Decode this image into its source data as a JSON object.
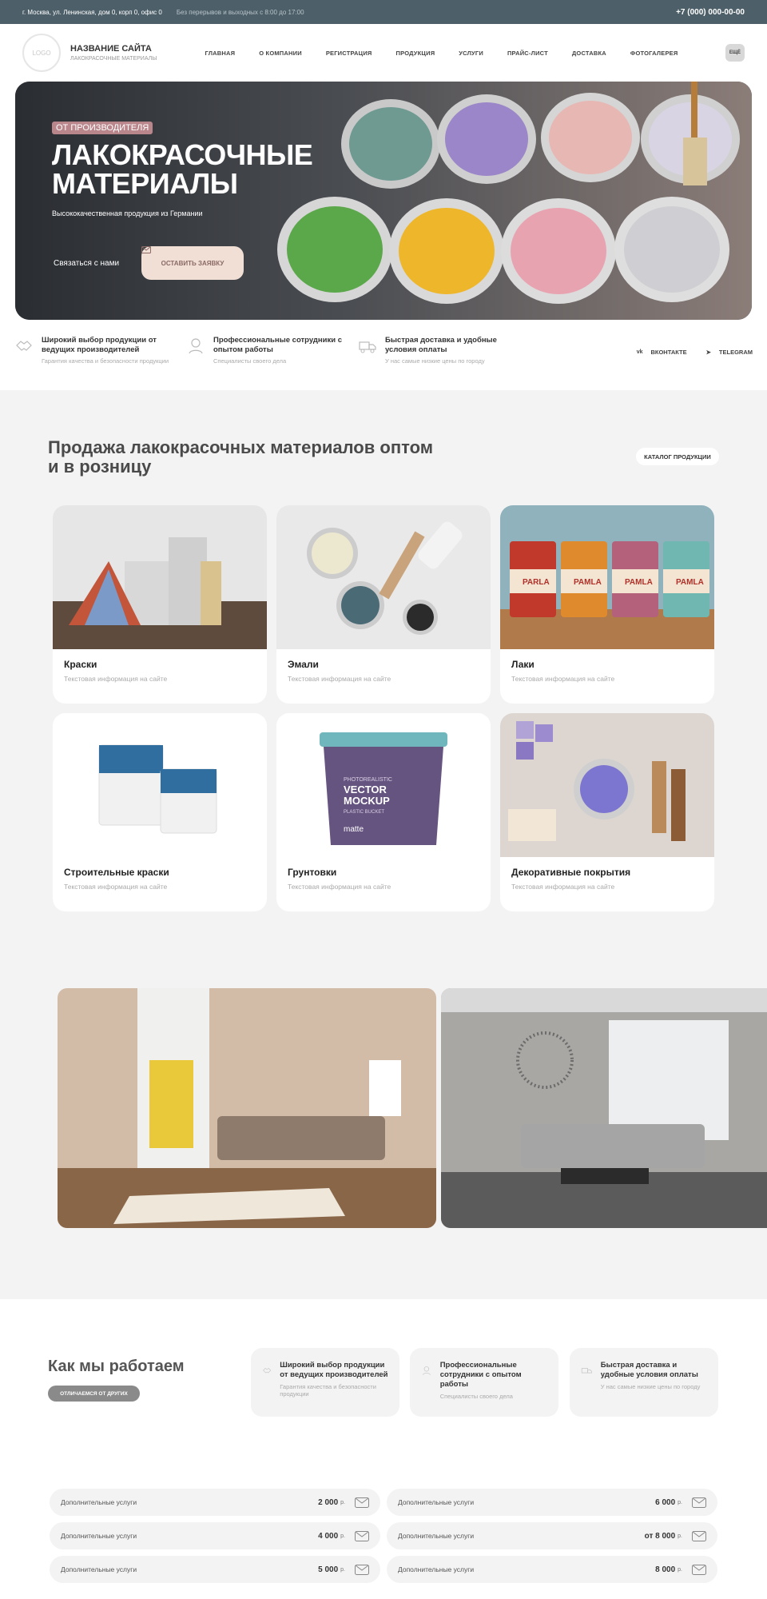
{
  "topbar": {
    "address": "г. Москва, ул. Ленинская, дом 0, корп 0, офис 0",
    "hours": "Без перерывов и выходных с 8:00 до 17:00",
    "phone": "+7 (000) 000-00-00"
  },
  "header": {
    "logo": "LOGO",
    "site_name": "НАЗВАНИЕ САЙТА",
    "site_sub": "ЛАКОКРАСОЧНЫЕ МАТЕРИАЛЫ",
    "nav": [
      "ГЛАВНАЯ",
      "О КОМПАНИИ",
      "РЕГИСТРАЦИЯ",
      "ПРОДУКЦИЯ",
      "УСЛУГИ",
      "ПРАЙС-ЛИСТ",
      "ДОСТАВКА",
      "ФОТОГАЛЕРЕЯ"
    ],
    "more": "ЕЩЁ"
  },
  "hero": {
    "badge": "ОТ ПРОИЗВОДИТЕЛЯ",
    "title_1": "ЛАКОКРАСОЧНЫЕ",
    "title_2": "МАТЕРИАЛЫ",
    "subtitle": "Высококачественная продукция из Германии",
    "contact": "Связаться с нами",
    "cta": "ОСТАВИТЬ ЗАЯВКУ"
  },
  "features": [
    {
      "title": "Широкий выбор продукции от ведущих производителей",
      "desc": "Гарантия качества и безопасности продукции"
    },
    {
      "title": "Профессиональные сотрудники с опытом работы",
      "desc": "Специалисты своего дела"
    },
    {
      "title": "Быстрая доставка и удобные условия оплаты",
      "desc": "У нас самые низкие цены по городу"
    }
  ],
  "social": {
    "vk": "ВКОНТАКТЕ",
    "tg": "TELEGRAM"
  },
  "catalog": {
    "title": "Продажа лакокрасочных материалов оптом и в розницу",
    "button": "КАТАЛОГ ПРОДУКЦИИ",
    "items": [
      {
        "name": "Краски",
        "desc": "Текстовая информация на сайте"
      },
      {
        "name": "Эмали",
        "desc": "Текстовая информация на сайте"
      },
      {
        "name": "Лаки",
        "desc": "Текстовая информация на сайте"
      },
      {
        "name": "Строительные краски",
        "desc": "Текстовая информация на сайте"
      },
      {
        "name": "Грунтовки",
        "desc": "Текстовая информация на сайте"
      },
      {
        "name": "Декоративные покрытия",
        "desc": "Текстовая информация на сайте"
      }
    ],
    "can_label": "PAMLA",
    "can_label_first": "PARLA",
    "bucket": [
      "PHOTOREALISTIC",
      "VECTOR",
      "MOCKUP",
      "PLASTIC BUCKET",
      "matte"
    ]
  },
  "how": {
    "title": "Как мы работаем",
    "badge": "ОТЛИЧАЕМСЯ ОТ ДРУГИХ",
    "cards": [
      {
        "title": "Широкий выбор продукции от ведущих производителей",
        "desc": "Гарантия качества и безопасности продукции"
      },
      {
        "title": "Профессиональные сотрудники с опытом работы",
        "desc": "Специалисты своего дела"
      },
      {
        "title": "Быстрая доставка и удобные условия оплаты",
        "desc": "У нас самые низкие цены по городу"
      }
    ]
  },
  "services": {
    "currency": "р.",
    "items": [
      {
        "label": "Дополнительные услуги",
        "price": "2 000"
      },
      {
        "label": "Дополнительные услуги",
        "price": "6 000"
      },
      {
        "label": "Дополнительные услуги",
        "price": "4 000"
      },
      {
        "label": "Дополнительные услуги",
        "price": "от 8 000"
      },
      {
        "label": "Дополнительные услуги",
        "price": "5 000"
      },
      {
        "label": "Дополнительные услуги",
        "price": "8 000"
      }
    ]
  },
  "colors": {
    "topbar": "#4d5f69",
    "badge": "#b9868c",
    "cta_bg": "#f1dfd6",
    "section_bg": "#f3f3f3"
  }
}
